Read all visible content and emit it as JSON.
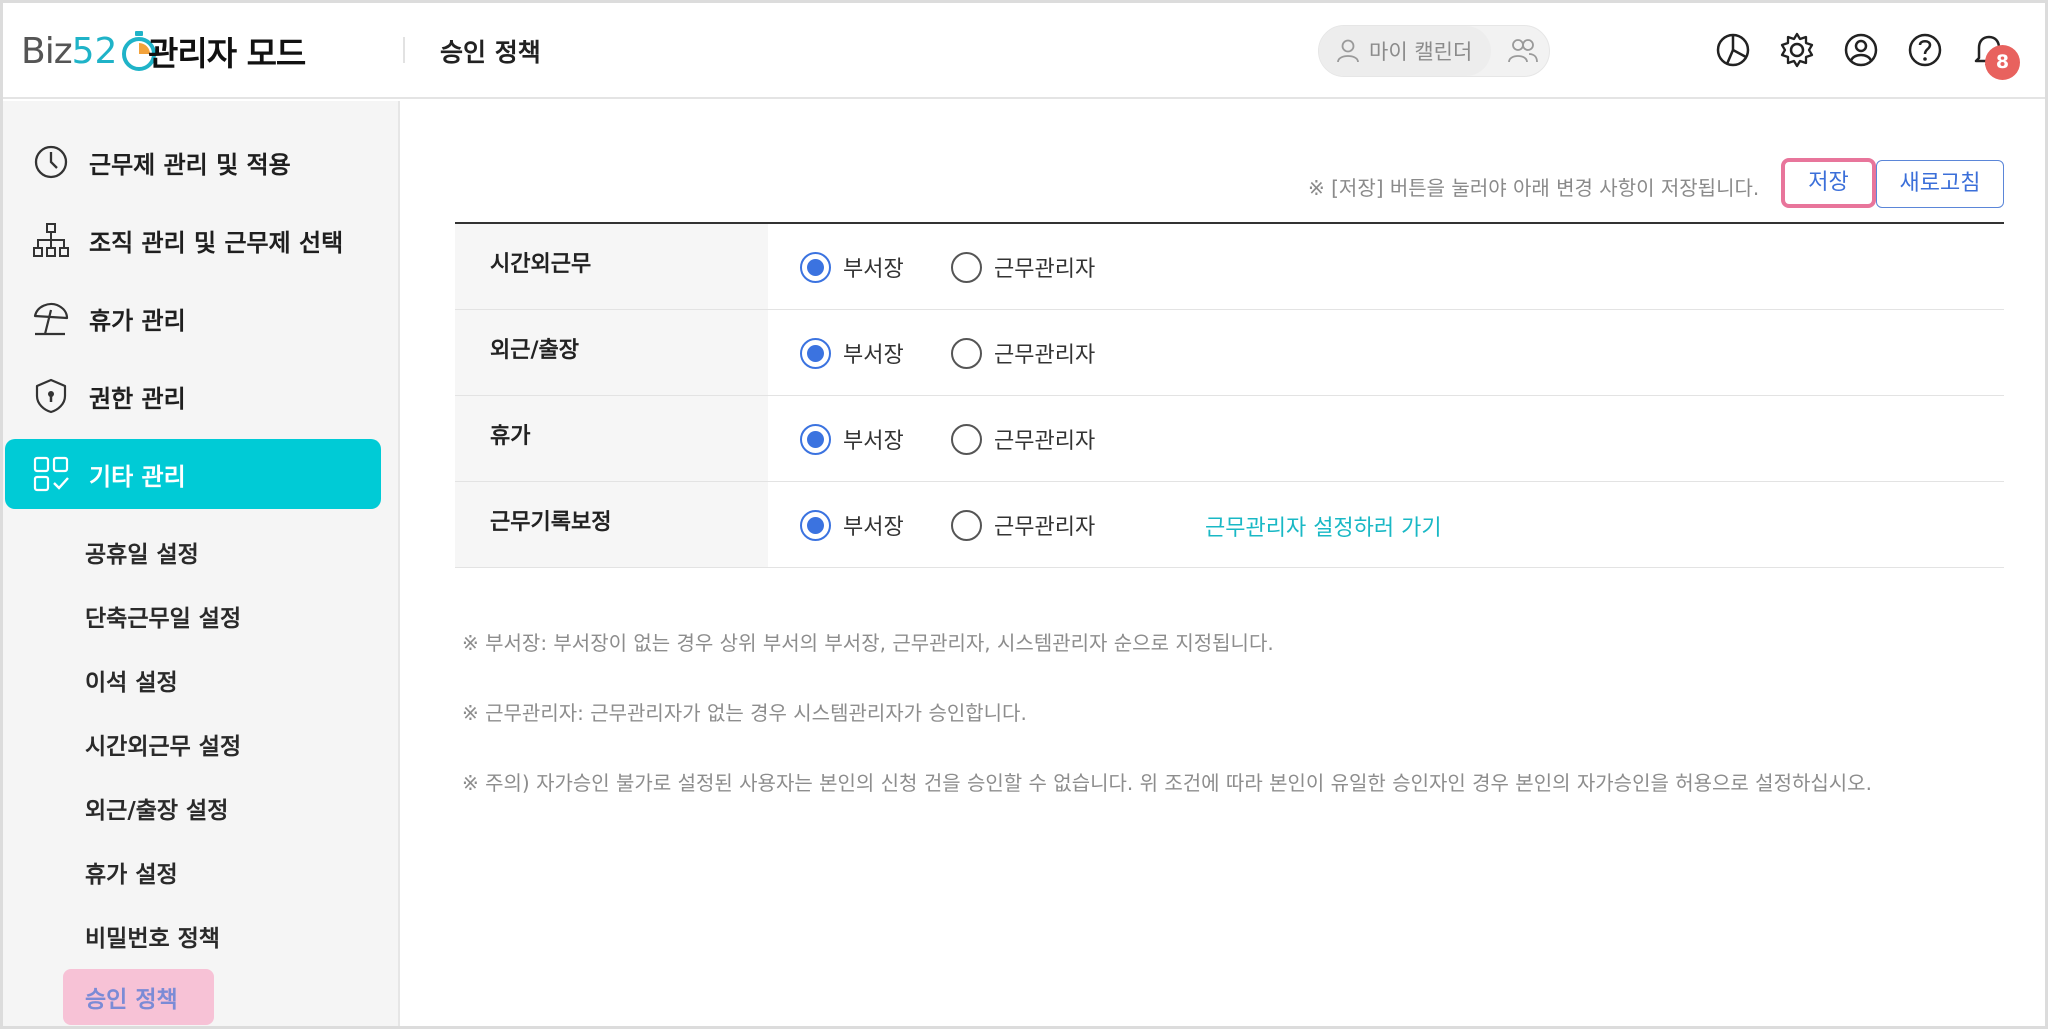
{
  "header": {
    "logo_text": "Biz",
    "logo_number": "52",
    "admin_title": "관리자 모드",
    "page_title": "승인 정책",
    "my_calendar_label": "마이 캘린더",
    "notification_count": "8"
  },
  "sidebar": {
    "menu": [
      {
        "label": "근무제 관리 및 적용",
        "icon": "clock-icon"
      },
      {
        "label": "조직 관리 및 근무제 선택",
        "icon": "org-chart-icon"
      },
      {
        "label": "휴가 관리",
        "icon": "umbrella-icon"
      },
      {
        "label": "권한 관리",
        "icon": "shield-lock-icon"
      },
      {
        "label": "기타 관리",
        "icon": "grid-check-icon"
      }
    ],
    "sub_items": [
      "공휴일 설정",
      "단축근무일 설정",
      "이석 설정",
      "시간외근무 설정",
      "외근/출장 설정",
      "휴가 설정",
      "비밀번호 정책",
      "승인 정책"
    ]
  },
  "main": {
    "save_notice": "※ [저장] 버튼을 눌러야 아래 변경 사항이 저장됩니다.",
    "save_label": "저장",
    "refresh_label": "새로고침",
    "option_head": "부서장",
    "option_manager": "근무관리자",
    "rows": [
      {
        "label": "시간외근무",
        "selected": "부서장"
      },
      {
        "label": "외근/출장",
        "selected": "부서장"
      },
      {
        "label": "휴가",
        "selected": "부서장"
      },
      {
        "label": "근무기록보정",
        "selected": "부서장"
      }
    ],
    "manager_link": "근무관리자 설정하러 가기",
    "notes": [
      "※ 부서장: 부서장이 없는 경우 상위 부서의 부서장, 근무관리자, 시스템관리자 순으로 지정됩니다.",
      "※ 근무관리자: 근무관리자가 없는 경우 시스템관리자가 승인합니다.",
      "※ 주의) 자가승인 불가로 설정된 사용자는 본인의 신청 건을 승인할 수 없습니다. 위 조건에 따라 본인이 유일한 승인자인 경우 본인의 자가승인을 허용으로 설정하십시오."
    ]
  },
  "colors": {
    "accent": "#00cbd6",
    "radio_active": "#3b73e0",
    "link": "#19b8c5",
    "badge": "#e8625e",
    "current_menu_bg": "#f7c2d6"
  }
}
